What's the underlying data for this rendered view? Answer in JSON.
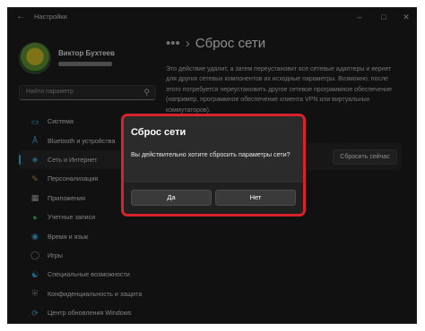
{
  "window": {
    "app_title": "Настройки",
    "back_icon": "arrow-left-icon",
    "controls": [
      "minimize-icon",
      "maximize-icon",
      "close-icon"
    ]
  },
  "user": {
    "name": "Виктор Бухтеев",
    "avatar": "avatar-image"
  },
  "search": {
    "placeholder": "Найти параметр",
    "icon": "search-icon"
  },
  "sidebar": {
    "items": [
      {
        "label": "Система",
        "icon": "monitor-icon",
        "color": "#4cc2ff"
      },
      {
        "label": "Bluetooth и устройства",
        "icon": "bluetooth-icon",
        "color": "#4cc2ff"
      },
      {
        "label": "Сеть и Интернет",
        "icon": "wifi-icon",
        "color": "#4cc2ff",
        "active": true
      },
      {
        "label": "Персонализация",
        "icon": "brush-icon",
        "color": "#e8a052"
      },
      {
        "label": "Приложения",
        "icon": "apps-icon",
        "color": "#c8c8c8"
      },
      {
        "label": "Учетные записи",
        "icon": "person-icon",
        "color": "#3ec46d"
      },
      {
        "label": "Время и язык",
        "icon": "globe-icon",
        "color": "#4cc2ff"
      },
      {
        "label": "Игры",
        "icon": "gamepad-icon",
        "color": "#b0b0b0"
      },
      {
        "label": "Специальные возможности",
        "icon": "accessibility-icon",
        "color": "#4cc2ff"
      },
      {
        "label": "Конфиденциальность и защита",
        "icon": "shield-icon",
        "color": "#9a9a9a"
      },
      {
        "label": "Центр обновления Windows",
        "icon": "sync-icon",
        "color": "#4cc2ff"
      }
    ]
  },
  "main": {
    "breadcrumb_dots": "•••",
    "breadcrumb_sep": "›",
    "title": "Сброс сети",
    "description": "Это действие удалит, а затем переустановит все сетевые адаптеры и вернет для других сетевых компонентов их исходные параметры. Возможно, после этого потребуется переустановить другое сетевое программное обеспечение (например, программное обеспечение клиента VPN или виртуальных коммутаторов).",
    "reset_now_label": "Сбросить сейчас"
  },
  "dialog": {
    "title": "Сброс сети",
    "message": "Вы действительно хотите сбросить параметры сети?",
    "yes_label": "Да",
    "no_label": "Нет",
    "highlight_color": "#d8232a"
  }
}
